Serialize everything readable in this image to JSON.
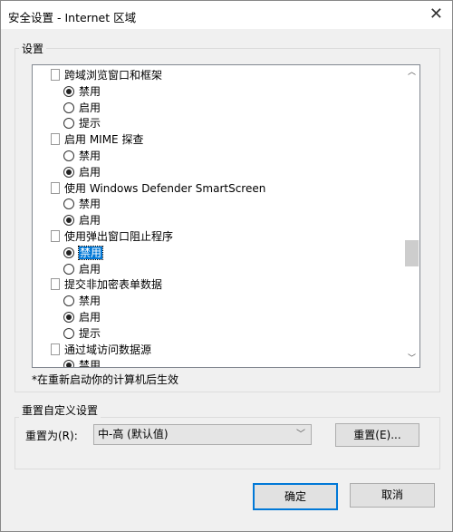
{
  "window": {
    "title": "安全设置 - Internet 区域",
    "close_icon": "close-icon"
  },
  "settings_group": {
    "label": "设置",
    "items": [
      {
        "type": "heading",
        "label": "跨域浏览窗口和框架"
      },
      {
        "type": "option",
        "label": "禁用",
        "checked": true
      },
      {
        "type": "option",
        "label": "启用",
        "checked": false
      },
      {
        "type": "option",
        "label": "提示",
        "checked": false
      },
      {
        "type": "heading",
        "label": "启用 MIME 探查"
      },
      {
        "type": "option",
        "label": "禁用",
        "checked": false
      },
      {
        "type": "option",
        "label": "启用",
        "checked": true
      },
      {
        "type": "heading",
        "label": "使用 Windows Defender SmartScreen"
      },
      {
        "type": "option",
        "label": "禁用",
        "checked": false
      },
      {
        "type": "option",
        "label": "启用",
        "checked": true
      },
      {
        "type": "heading",
        "label": "使用弹出窗口阻止程序"
      },
      {
        "type": "option",
        "label": "禁用",
        "checked": true,
        "selected": true
      },
      {
        "type": "option",
        "label": "启用",
        "checked": false
      },
      {
        "type": "heading",
        "label": "提交非加密表单数据"
      },
      {
        "type": "option",
        "label": "禁用",
        "checked": false
      },
      {
        "type": "option",
        "label": "启用",
        "checked": true
      },
      {
        "type": "option",
        "label": "提示",
        "checked": false
      },
      {
        "type": "heading",
        "label": "通过域访问数据源"
      },
      {
        "type": "option",
        "label": "禁用",
        "checked": true
      }
    ],
    "note": "*在重新启动你的计算机后生效"
  },
  "reset_group": {
    "label": "重置自定义设置",
    "reset_to_label": "重置为(R):",
    "reset_to_value": "中-高 (默认值)",
    "reset_button": "重置(E)..."
  },
  "footer": {
    "ok": "确定",
    "cancel": "取消"
  },
  "colors": {
    "selection": "#0078d7",
    "default_button_border": "#0078d7"
  }
}
